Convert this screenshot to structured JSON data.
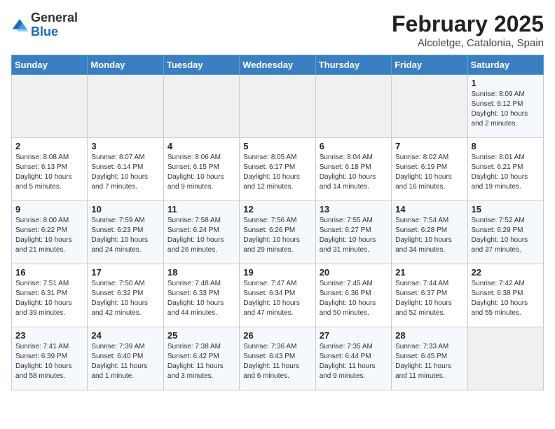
{
  "header": {
    "logo_general": "General",
    "logo_blue": "Blue",
    "month_title": "February 2025",
    "location": "Alcoletge, Catalonia, Spain"
  },
  "weekdays": [
    "Sunday",
    "Monday",
    "Tuesday",
    "Wednesday",
    "Thursday",
    "Friday",
    "Saturday"
  ],
  "weeks": [
    [
      {
        "day": "",
        "info": ""
      },
      {
        "day": "",
        "info": ""
      },
      {
        "day": "",
        "info": ""
      },
      {
        "day": "",
        "info": ""
      },
      {
        "day": "",
        "info": ""
      },
      {
        "day": "",
        "info": ""
      },
      {
        "day": "1",
        "info": "Sunrise: 8:09 AM\nSunset: 6:12 PM\nDaylight: 10 hours\nand 2 minutes."
      }
    ],
    [
      {
        "day": "2",
        "info": "Sunrise: 8:08 AM\nSunset: 6:13 PM\nDaylight: 10 hours\nand 5 minutes."
      },
      {
        "day": "3",
        "info": "Sunrise: 8:07 AM\nSunset: 6:14 PM\nDaylight: 10 hours\nand 7 minutes."
      },
      {
        "day": "4",
        "info": "Sunrise: 8:06 AM\nSunset: 6:15 PM\nDaylight: 10 hours\nand 9 minutes."
      },
      {
        "day": "5",
        "info": "Sunrise: 8:05 AM\nSunset: 6:17 PM\nDaylight: 10 hours\nand 12 minutes."
      },
      {
        "day": "6",
        "info": "Sunrise: 8:04 AM\nSunset: 6:18 PM\nDaylight: 10 hours\nand 14 minutes."
      },
      {
        "day": "7",
        "info": "Sunrise: 8:02 AM\nSunset: 6:19 PM\nDaylight: 10 hours\nand 16 minutes."
      },
      {
        "day": "8",
        "info": "Sunrise: 8:01 AM\nSunset: 6:21 PM\nDaylight: 10 hours\nand 19 minutes."
      }
    ],
    [
      {
        "day": "9",
        "info": "Sunrise: 8:00 AM\nSunset: 6:22 PM\nDaylight: 10 hours\nand 21 minutes."
      },
      {
        "day": "10",
        "info": "Sunrise: 7:59 AM\nSunset: 6:23 PM\nDaylight: 10 hours\nand 24 minutes."
      },
      {
        "day": "11",
        "info": "Sunrise: 7:58 AM\nSunset: 6:24 PM\nDaylight: 10 hours\nand 26 minutes."
      },
      {
        "day": "12",
        "info": "Sunrise: 7:56 AM\nSunset: 6:26 PM\nDaylight: 10 hours\nand 29 minutes."
      },
      {
        "day": "13",
        "info": "Sunrise: 7:55 AM\nSunset: 6:27 PM\nDaylight: 10 hours\nand 31 minutes."
      },
      {
        "day": "14",
        "info": "Sunrise: 7:54 AM\nSunset: 6:28 PM\nDaylight: 10 hours\nand 34 minutes."
      },
      {
        "day": "15",
        "info": "Sunrise: 7:52 AM\nSunset: 6:29 PM\nDaylight: 10 hours\nand 37 minutes."
      }
    ],
    [
      {
        "day": "16",
        "info": "Sunrise: 7:51 AM\nSunset: 6:31 PM\nDaylight: 10 hours\nand 39 minutes."
      },
      {
        "day": "17",
        "info": "Sunrise: 7:50 AM\nSunset: 6:32 PM\nDaylight: 10 hours\nand 42 minutes."
      },
      {
        "day": "18",
        "info": "Sunrise: 7:48 AM\nSunset: 6:33 PM\nDaylight: 10 hours\nand 44 minutes."
      },
      {
        "day": "19",
        "info": "Sunrise: 7:47 AM\nSunset: 6:34 PM\nDaylight: 10 hours\nand 47 minutes."
      },
      {
        "day": "20",
        "info": "Sunrise: 7:45 AM\nSunset: 6:36 PM\nDaylight: 10 hours\nand 50 minutes."
      },
      {
        "day": "21",
        "info": "Sunrise: 7:44 AM\nSunset: 6:37 PM\nDaylight: 10 hours\nand 52 minutes."
      },
      {
        "day": "22",
        "info": "Sunrise: 7:42 AM\nSunset: 6:38 PM\nDaylight: 10 hours\nand 55 minutes."
      }
    ],
    [
      {
        "day": "23",
        "info": "Sunrise: 7:41 AM\nSunset: 6:39 PM\nDaylight: 10 hours\nand 58 minutes."
      },
      {
        "day": "24",
        "info": "Sunrise: 7:39 AM\nSunset: 6:40 PM\nDaylight: 11 hours\nand 1 minute."
      },
      {
        "day": "25",
        "info": "Sunrise: 7:38 AM\nSunset: 6:42 PM\nDaylight: 11 hours\nand 3 minutes."
      },
      {
        "day": "26",
        "info": "Sunrise: 7:36 AM\nSunset: 6:43 PM\nDaylight: 11 hours\nand 6 minutes."
      },
      {
        "day": "27",
        "info": "Sunrise: 7:35 AM\nSunset: 6:44 PM\nDaylight: 11 hours\nand 9 minutes."
      },
      {
        "day": "28",
        "info": "Sunrise: 7:33 AM\nSunset: 6:45 PM\nDaylight: 11 hours\nand 11 minutes."
      },
      {
        "day": "",
        "info": ""
      }
    ]
  ]
}
